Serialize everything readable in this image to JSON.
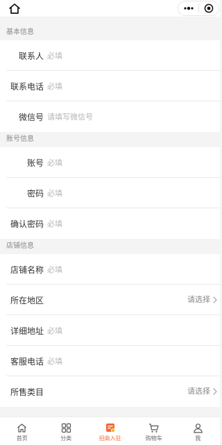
{
  "sections": [
    {
      "title": "基本信息",
      "rows": [
        {
          "label": "联系人",
          "placeholder": "必填"
        },
        {
          "label": "联系电话",
          "placeholder": "必填"
        },
        {
          "label": "微信号",
          "placeholder": "请填写微信号"
        }
      ]
    },
    {
      "title": "账号信息",
      "rows": [
        {
          "label": "账号",
          "placeholder": "必填"
        },
        {
          "label": "密码",
          "placeholder": "必填"
        },
        {
          "label": "确认密码",
          "placeholder": "必填"
        }
      ]
    },
    {
      "title": "店铺信息",
      "rows": [
        {
          "label": "店铺名称",
          "placeholder": "必填"
        },
        {
          "label": "所在地区",
          "picker": "请选择"
        },
        {
          "label": "详细地址",
          "placeholder": "必填"
        },
        {
          "label": "客服电话",
          "placeholder": "必填"
        },
        {
          "label": "所售类目",
          "picker": "请选择"
        }
      ]
    }
  ],
  "tabbar": {
    "items": [
      {
        "label": "首页",
        "icon": "home-icon"
      },
      {
        "label": "分类",
        "icon": "category-icon"
      },
      {
        "label": "招商入驻",
        "icon": "merchant-icon",
        "active": true
      },
      {
        "label": "购物车",
        "icon": "cart-icon"
      },
      {
        "label": "我",
        "icon": "user-icon"
      }
    ],
    "active_color": "#f26a36"
  },
  "colors": {
    "background": "#f4f4f4",
    "section_text": "#888888",
    "placeholder": "#b6b6b6"
  }
}
